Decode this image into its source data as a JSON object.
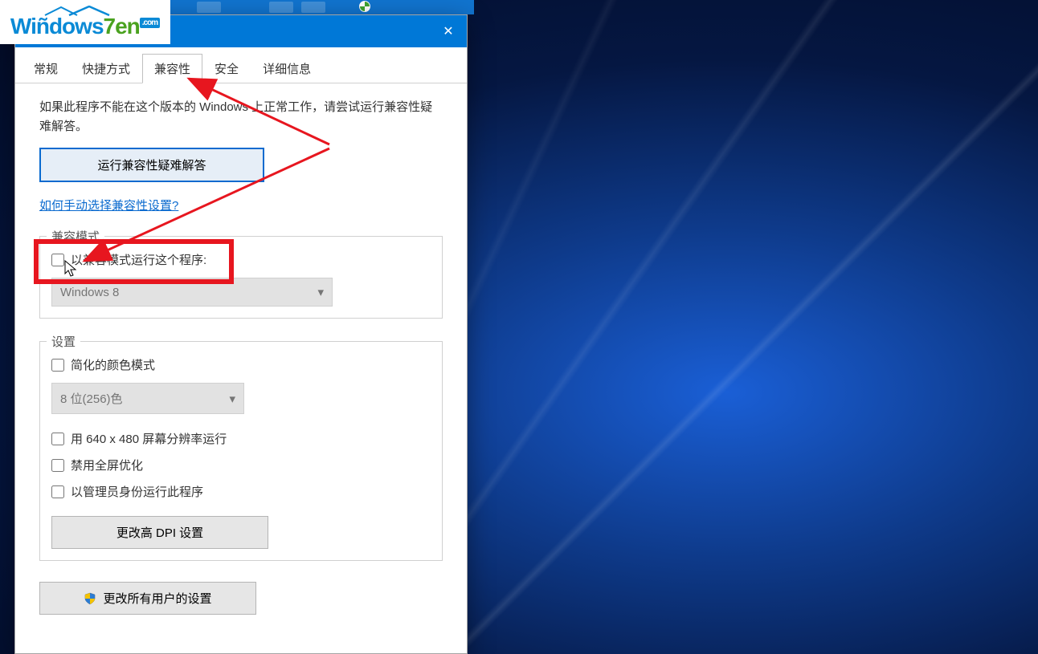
{
  "logo": {
    "brand_part1": "Wiñdows",
    "brand_part2": "7en",
    "tld": ".com"
  },
  "dialog": {
    "close": "✕",
    "tabs": {
      "general": "常规",
      "shortcut": "快捷方式",
      "compatibility": "兼容性",
      "security": "安全",
      "details": "详细信息"
    },
    "help_text": "如果此程序不能在这个版本的 Windows 上正常工作，请尝试运行兼容性疑难解答。",
    "troubleshoot_button": "运行兼容性疑难解答",
    "manual_link": "如何手动选择兼容性设置?",
    "compat_mode": {
      "legend": "兼容模式",
      "checkbox": "以兼容模式运行这个程序:",
      "dropdown": "Windows 8"
    },
    "settings": {
      "legend": "设置",
      "reduced_color": "简化的颜色模式",
      "color_dropdown": "8 位(256)色",
      "resolution": "用 640 x 480 屏幕分辨率运行",
      "disable_fullscreen": "禁用全屏优化",
      "run_as_admin": "以管理员身份运行此程序",
      "dpi_button": "更改高 DPI 设置"
    },
    "all_users_button": "更改所有用户的设置"
  }
}
